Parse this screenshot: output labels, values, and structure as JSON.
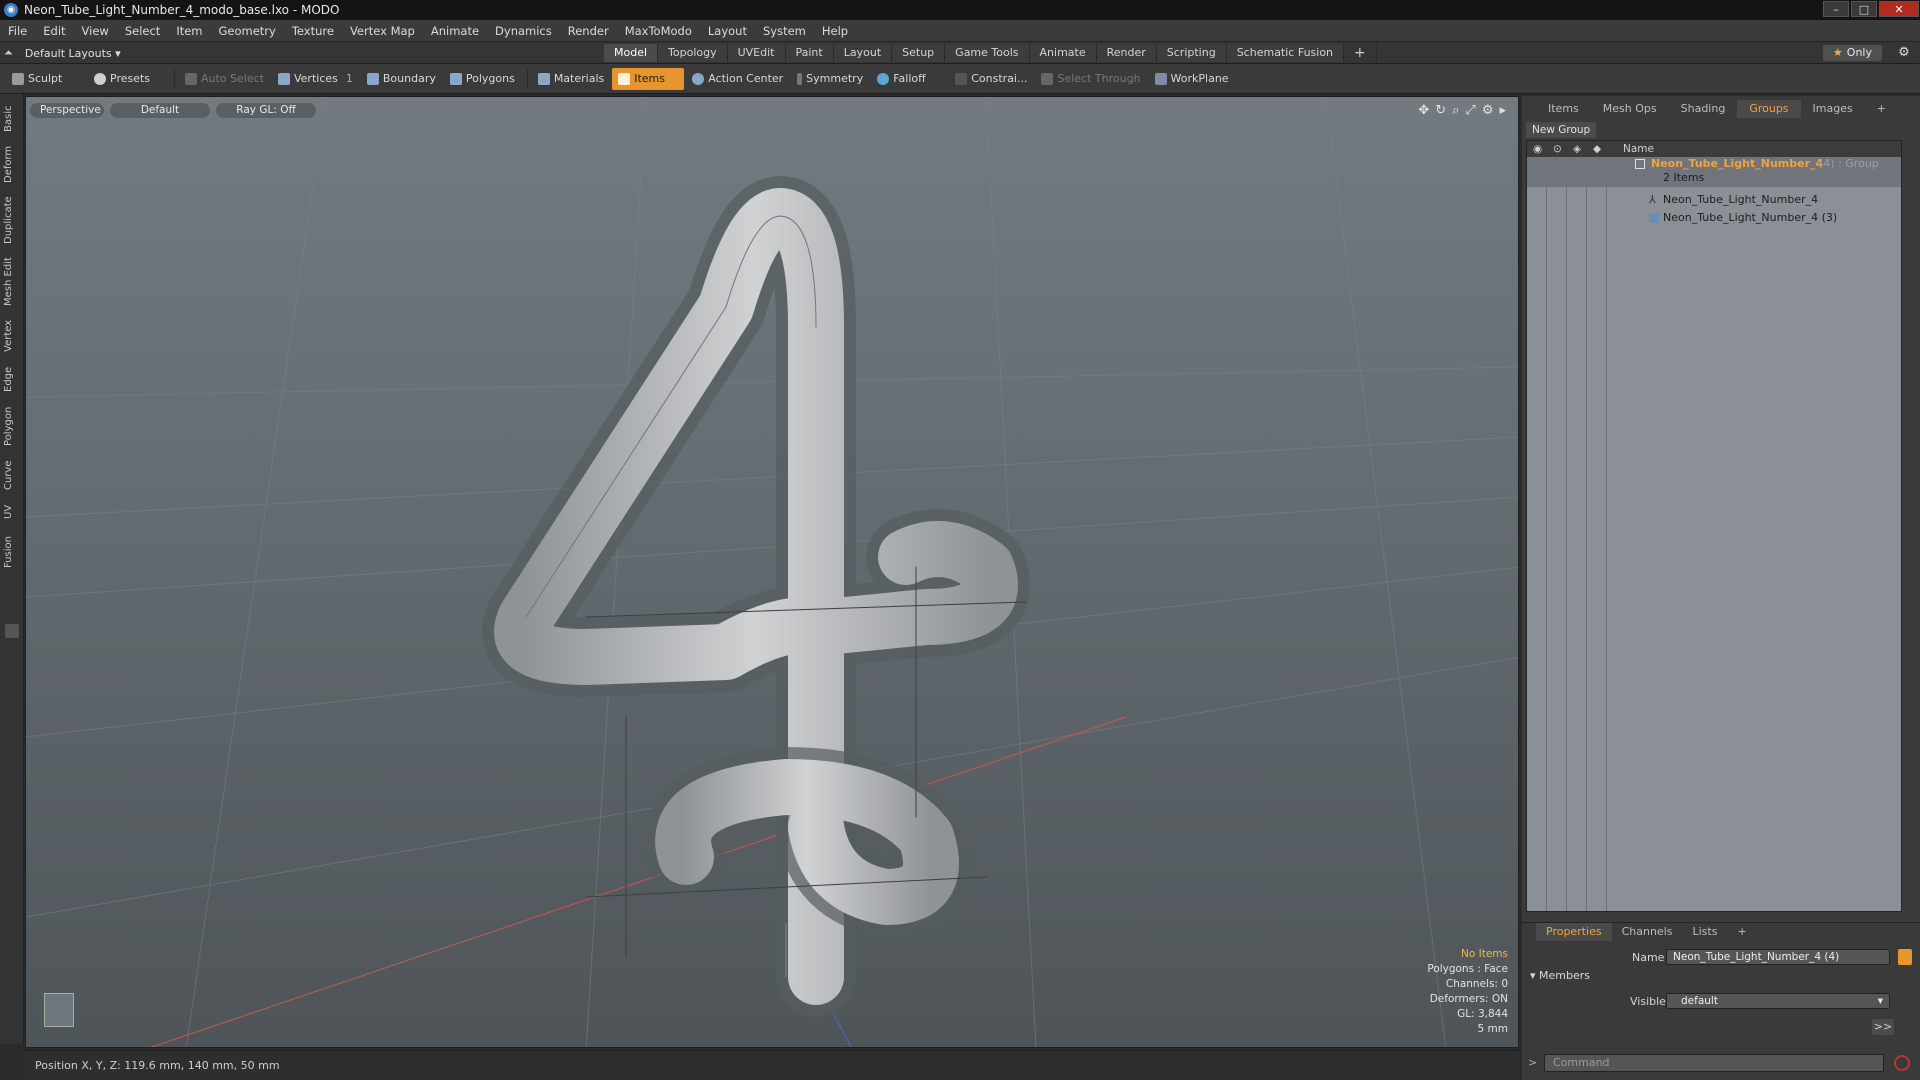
{
  "window": {
    "title": "Neon_Tube_Light_Number_4_modo_base.lxo - MODO",
    "min": "–",
    "max": "□",
    "close": "✕"
  },
  "menu": [
    "File",
    "Edit",
    "View",
    "Select",
    "Item",
    "Geometry",
    "Texture",
    "Vertex Map",
    "Animate",
    "Dynamics",
    "Render",
    "MaxToModo",
    "Layout",
    "System",
    "Help"
  ],
  "layoutbar": {
    "layouts_label": "Default Layouts ▾",
    "tabs": [
      "Model",
      "Topology",
      "UVEdit",
      "Paint",
      "Layout",
      "Setup",
      "Game Tools",
      "Animate",
      "Render",
      "Scripting",
      "Schematic Fusion"
    ],
    "active_tab": "Model",
    "add": "+",
    "only_label": "Only"
  },
  "toolbar": {
    "sculpt": "Sculpt",
    "presets": "Presets",
    "auto_select": "Auto Select",
    "vertices": "Vertices",
    "vertices_count": "1",
    "boundary": "Boundary",
    "polygons": "Polygons",
    "materials": "Materials",
    "items": "Items",
    "action_center": "Action Center",
    "symmetry": "Symmetry",
    "falloff": "Falloff",
    "constrain": "Constrai...",
    "select_through": "Select Through",
    "workplane": "WorkPlane"
  },
  "left_tabs": [
    "Basic",
    "Deform",
    "Duplicate",
    "Mesh Edit",
    "Vertex",
    "Edge",
    "Polygon",
    "Curve",
    "UV",
    "Fusion"
  ],
  "viewport": {
    "view": "Perspective",
    "style": "Default",
    "raygl": "Ray GL: Off",
    "info": {
      "selection": "No Items",
      "polygons": "Polygons : Face",
      "channels": "Channels: 0",
      "deformers": "Deformers: ON",
      "gl": "GL: 3,844",
      "unit": "5 mm"
    }
  },
  "status": {
    "position": "Position X, Y, Z:  119.6 mm, 140 mm, 50 mm"
  },
  "right_panel": {
    "tabs": [
      "Items",
      "Mesh Ops",
      "Shading",
      "Groups",
      "Images"
    ],
    "active_tab": "Groups",
    "add": "+",
    "new_group": "New Group",
    "column_name": "Name",
    "group": {
      "name": "Neon_Tube_Light_Number_4",
      "suffix": "(4) : Group",
      "count": "2 Items"
    },
    "items": [
      "Neon_Tube_Light_Number_4",
      "Neon_Tube_Light_Number_4 (3)"
    ]
  },
  "properties": {
    "tabs": [
      "Properties",
      "Channels",
      "Lists"
    ],
    "add": "+",
    "name_label": "Name",
    "name_value": "Neon_Tube_Light_Number_4 (4)",
    "members_label": "Members",
    "visible_label": "Visible",
    "visible_value": "default",
    "more": ">>"
  },
  "command": {
    "placeholder": "Command",
    "prompt": ">"
  },
  "colors": {
    "accent": "#e7962e",
    "viewport_top": "#727a80",
    "viewport_bottom": "#4e5458",
    "group_name": "#f2a23c"
  }
}
